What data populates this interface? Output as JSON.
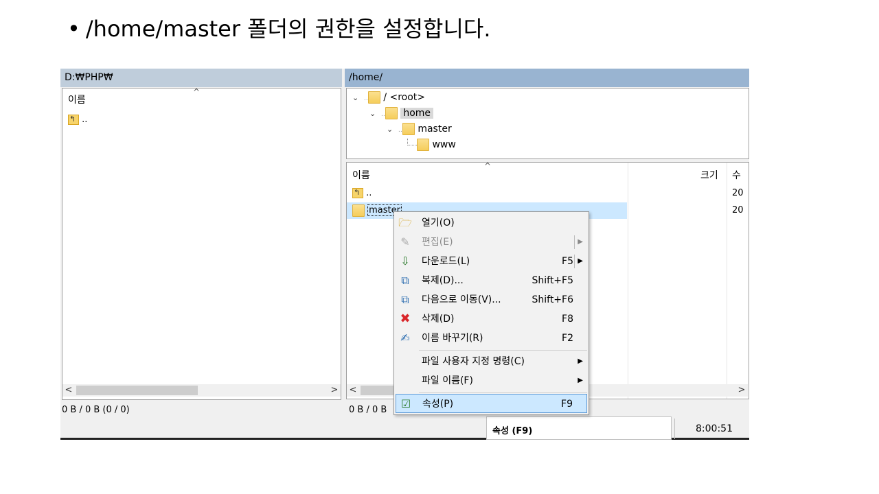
{
  "slide": {
    "bullet": "•",
    "title": "/home/master 폴더의 권한을 설정합니다."
  },
  "left_panel": {
    "path": "D:₩PHP₩",
    "column_name": "이름",
    "rows": [
      ".."
    ],
    "status": "0 B / 0 B (0 / 0)"
  },
  "right_panel": {
    "path": "/home/",
    "tree": [
      {
        "label": "/ <root>",
        "icon": "folder-icon"
      },
      {
        "label": "home",
        "icon": "folder-icon"
      },
      {
        "label": "master",
        "icon": "folder-icon"
      },
      {
        "label": "www",
        "icon": "folder-icon"
      }
    ],
    "columns": {
      "name": "이름",
      "size": "크기",
      "modified": "수"
    },
    "files": [
      {
        "name": "..",
        "modified": "20"
      },
      {
        "name": "master",
        "modified": "20"
      }
    ],
    "status": "0 B / 0 B"
  },
  "context_menu": {
    "items": [
      {
        "label": "열기(O)",
        "shortcut": "",
        "icon": "open-folder-icon"
      },
      {
        "label": "편집(E)",
        "shortcut": "",
        "icon": "edit-icon",
        "disabled": true
      },
      {
        "label": "다운로드(L)",
        "shortcut": "F5",
        "icon": "download-icon"
      },
      {
        "label": "복제(D)...",
        "shortcut": "Shift+F5",
        "icon": "duplicate-icon"
      },
      {
        "label": "다음으로 이동(V)...",
        "shortcut": "Shift+F6",
        "icon": "move-icon"
      },
      {
        "label": "삭제(D)",
        "shortcut": "F8",
        "icon": "delete-icon"
      },
      {
        "label": "이름 바꾸기(R)",
        "shortcut": "F2",
        "icon": "rename-icon"
      },
      {
        "label": "파일 사용자 지정 명령(C)",
        "shortcut": "",
        "icon": ""
      },
      {
        "label": "파일 이름(F)",
        "shortcut": "",
        "icon": ""
      },
      {
        "label": "속성(P)",
        "shortcut": "F9",
        "icon": "properties-icon"
      }
    ]
  },
  "tooltip": "속성 (F9)",
  "clock": "8:00:51",
  "colors": {
    "highlight": "#cce8ff",
    "left_path_bar": "#bfcddb",
    "right_path_bar": "#99b4d1",
    "delete_red": "#d9262a"
  }
}
